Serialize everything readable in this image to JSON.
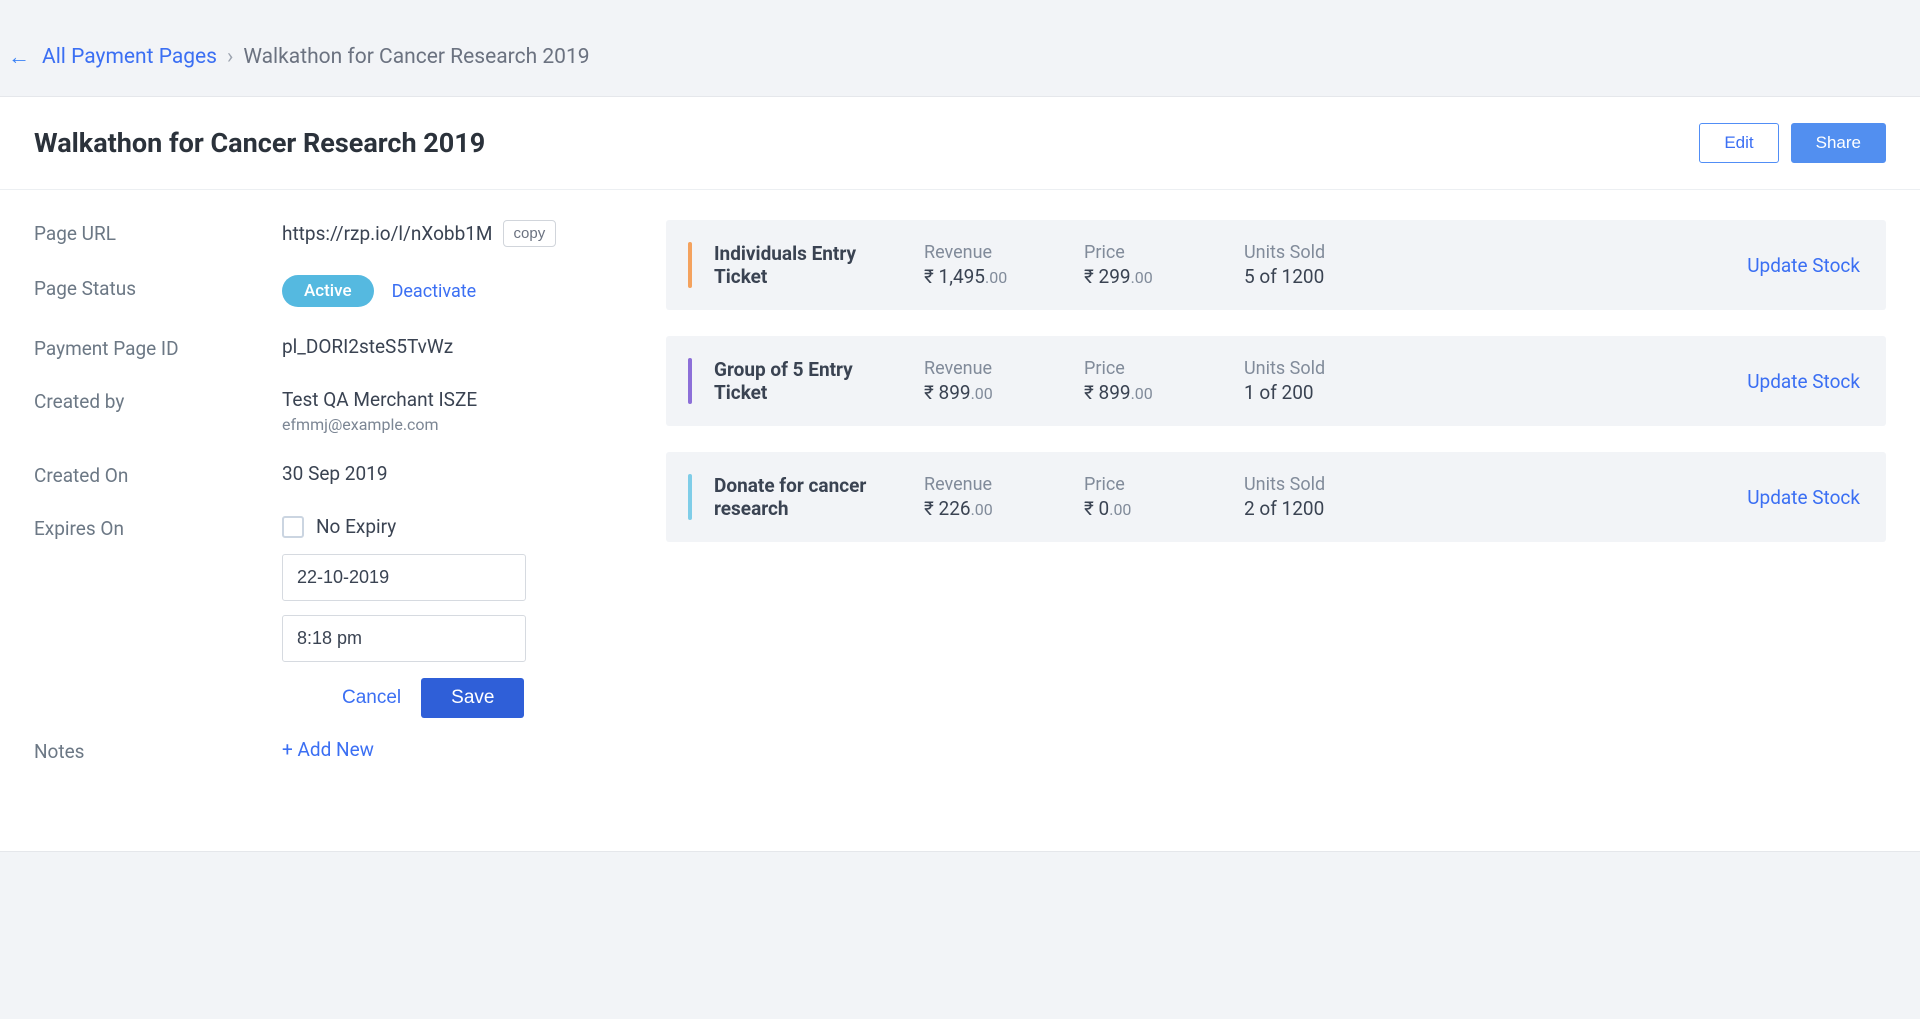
{
  "breadcrumb": {
    "root": "All Payment Pages",
    "current": "Walkathon for Cancer Research 2019"
  },
  "header": {
    "title": "Walkathon for Cancer Research 2019",
    "edit_label": "Edit",
    "share_label": "Share"
  },
  "fields": {
    "page_url": {
      "label": "Page URL",
      "value": "https://rzp.io/l/nXobb1M",
      "copy_label": "copy"
    },
    "page_status": {
      "label": "Page Status",
      "status": "Active",
      "deactivate_label": "Deactivate"
    },
    "payment_page_id": {
      "label": "Payment Page ID",
      "value": "pl_DORI2steS5TvWz"
    },
    "created_by": {
      "label": "Created by",
      "name": "Test QA Merchant ISZE",
      "email": "efmmj@example.com"
    },
    "created_on": {
      "label": "Created On",
      "value": "30 Sep 2019"
    },
    "expires_on": {
      "label": "Expires On",
      "no_expiry_label": "No Expiry",
      "date_value": "22-10-2019",
      "time_value": "8:18 pm",
      "cancel_label": "Cancel",
      "save_label": "Save"
    },
    "notes": {
      "label": "Notes",
      "add_new_label": "+ Add New"
    }
  },
  "metrics_labels": {
    "revenue": "Revenue",
    "price": "Price",
    "units_sold": "Units Sold"
  },
  "update_stock_label": "Update Stock",
  "items": [
    {
      "name": "Individuals Entry Ticket",
      "revenue_main": "₹ 1,495",
      "revenue_dec": ".00",
      "price_main": "₹ 299",
      "price_dec": ".00",
      "units_sold": "5 of 1200",
      "stripe": "stripe-orange"
    },
    {
      "name": "Group of 5 Entry Ticket",
      "revenue_main": "₹ 899",
      "revenue_dec": ".00",
      "price_main": "₹ 899",
      "price_dec": ".00",
      "units_sold": "1 of 200",
      "stripe": "stripe-purple"
    },
    {
      "name": "Donate for cancer research",
      "revenue_main": "₹ 226",
      "revenue_dec": ".00",
      "price_main": "₹ 0",
      "price_dec": ".00",
      "units_sold": "2 of 1200",
      "stripe": "stripe-cyan"
    }
  ]
}
